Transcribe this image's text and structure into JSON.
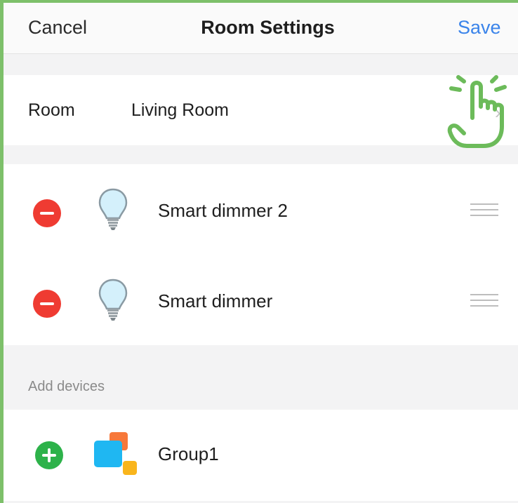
{
  "navbar": {
    "cancel_label": "Cancel",
    "title": "Room Settings",
    "save_label": "Save"
  },
  "room": {
    "label": "Room",
    "value": "Living Room"
  },
  "devices": [
    {
      "name": "Smart dimmer 2",
      "icon": "lightbulb-icon"
    },
    {
      "name": "Smart dimmer",
      "icon": "lightbulb-icon"
    }
  ],
  "add_section": {
    "header": "Add devices",
    "items": [
      {
        "name": "Group1",
        "icon": "group-icon"
      }
    ]
  },
  "colors": {
    "accent": "#3b84ea",
    "remove": "#ef3b32",
    "add": "#2db24a",
    "highlight": "#7dc06a"
  }
}
